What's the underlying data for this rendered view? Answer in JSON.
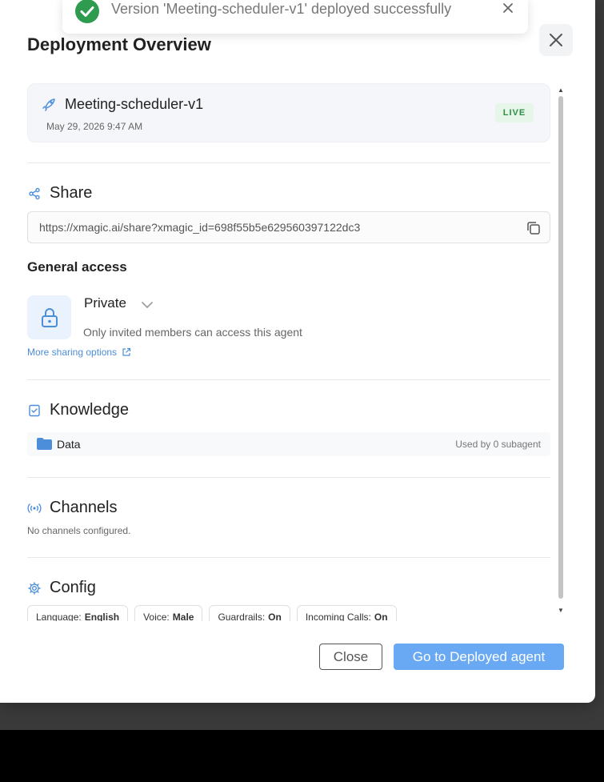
{
  "toast": {
    "message": "Version 'Meeting-scheduler-v1' deployed successfully"
  },
  "modal": {
    "title": "Deployment Overview",
    "version": {
      "name": "Meeting-scheduler-v1",
      "date": "May 29, 2026 9:47 AM",
      "status": "LIVE"
    },
    "share": {
      "title": "Share",
      "url": "https://xmagic.ai/share?xmagic_id=698f55b5e629560397122dc3",
      "general_access_label": "General access",
      "access_value": "Private",
      "access_description": "Only invited members can access this agent",
      "more_options": "More sharing options"
    },
    "knowledge": {
      "title": "Knowledge",
      "items": [
        {
          "name": "Data",
          "used_by": "Used by 0 subagent"
        }
      ]
    },
    "channels": {
      "title": "Channels",
      "empty_text": "No channels configured."
    },
    "config": {
      "title": "Config",
      "chips": [
        {
          "label": "Language:",
          "value": "English"
        },
        {
          "label": "Voice:",
          "value": "Male"
        },
        {
          "label": "Guardrails:",
          "value": "On"
        },
        {
          "label": "Incoming Calls:",
          "value": "On"
        }
      ]
    },
    "buttons": {
      "close": "Close",
      "go": "Go to Deployed agent"
    }
  },
  "colors": {
    "accent": "#69a8f2",
    "success": "#2e9b4f",
    "live_badge_text": "#2f8f46",
    "icon_blue": "#4c8ed9"
  },
  "icons": {
    "toast_icon": "check-circle-icon",
    "toast_close": "close-icon",
    "modal_close": "close-icon",
    "version": "rocket-icon",
    "share": "share-icon",
    "copy": "copy-icon",
    "access": "lock-icon",
    "dropdown": "chevron-down-icon",
    "external": "external-link-icon",
    "knowledge": "checklist-icon",
    "folder": "folder-icon",
    "channels": "broadcast-icon",
    "config": "gear-icon"
  }
}
